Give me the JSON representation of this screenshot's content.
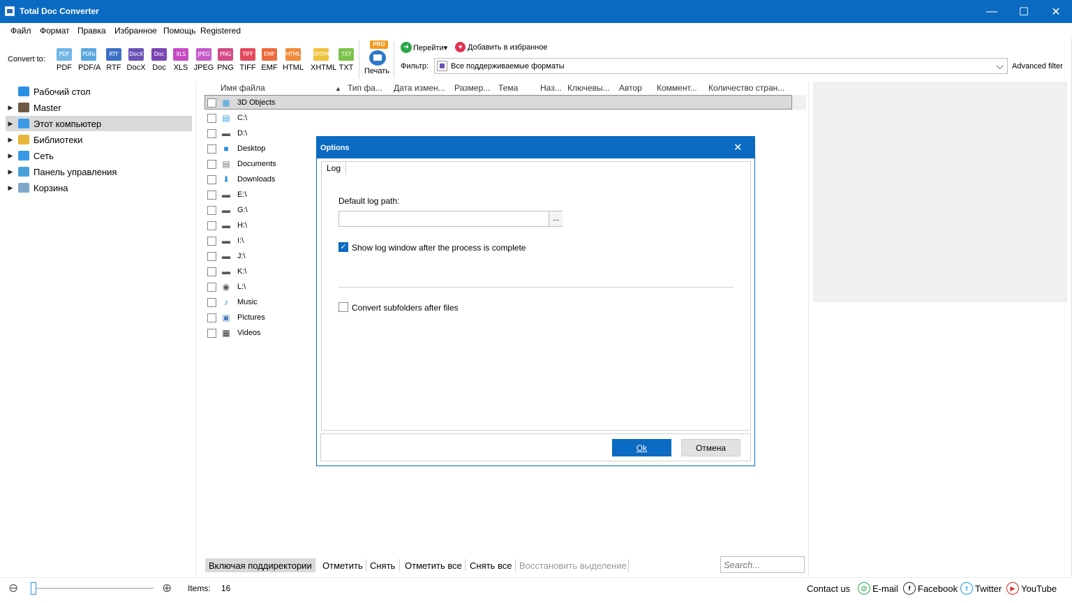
{
  "app": {
    "title": "Total Doc Converter"
  },
  "menu": [
    "Файл",
    "Формат",
    "Правка",
    "Избранное",
    "Помощь",
    "Registered"
  ],
  "toolbar": {
    "convert_to": "Convert to:",
    "formats": [
      {
        "icon": "PDF",
        "label": "PDF",
        "color": "#6fb6e6"
      },
      {
        "icon": "PDFa",
        "label": "PDF/A",
        "color": "#5aa7df"
      },
      {
        "icon": "RTF",
        "label": "RTF",
        "color": "#3b6fc6"
      },
      {
        "icon": "DocX",
        "label": "DocX",
        "color": "#6a52b5"
      },
      {
        "icon": "Doc",
        "label": "Doc",
        "color": "#7a45b0"
      },
      {
        "icon": "XLS",
        "label": "XLS",
        "color": "#c64bc2"
      },
      {
        "icon": "JPEG",
        "label": "JPEG",
        "color": "#c45ac9"
      },
      {
        "icon": "PNG",
        "label": "PNG",
        "color": "#d34a86"
      },
      {
        "icon": "TIFF",
        "label": "TIFF",
        "color": "#e24a5c"
      },
      {
        "icon": "EMF",
        "label": "EMF",
        "color": "#ec6a3b"
      },
      {
        "icon": "HTML",
        "label": "HTML",
        "color": "#f08a3b"
      },
      {
        "icon": "XHTML",
        "label": "XHTML",
        "color": "#f0c23b"
      },
      {
        "icon": "TXT",
        "label": "TXT",
        "color": "#7cc24a"
      }
    ],
    "pro_badge": "PRO",
    "print_label": "Печать",
    "goto_label": "Перейти",
    "goto_arrow": "▾",
    "favorites_label": "Добавить в избранное",
    "filter_label": "Фильтр:",
    "filter_value": "Все поддерживаемые форматы",
    "advanced_filter": "Advanced filter"
  },
  "tree": [
    {
      "label": "Рабочий стол",
      "arrow": "",
      "color": "#2b8fe3"
    },
    {
      "label": "Master",
      "arrow": "▶",
      "color": "#6e5a45"
    },
    {
      "label": "Этот компьютер",
      "arrow": "▶",
      "color": "#3a9ae8"
    },
    {
      "label": "Библиотеки",
      "arrow": "▶",
      "color": "#e8b63a"
    },
    {
      "label": "Сеть",
      "arrow": "▶",
      "color": "#3a9ae8"
    },
    {
      "label": "Панель управления",
      "arrow": "▶",
      "color": "#4aa3d8"
    },
    {
      "label": "Корзина",
      "arrow": "▶",
      "color": "#7fa7c9"
    }
  ],
  "columns": [
    "Имя файла",
    "Тип фа...",
    "Дата измен...",
    "Размер...",
    "Тема",
    "Наз...",
    "Ключевы...",
    "Автор",
    "Коммент...",
    "Количество стран..."
  ],
  "sort_arrow": "▲",
  "files": [
    {
      "name": "3D Objects",
      "icon": "▦",
      "color": "#3aa0e0"
    },
    {
      "name": "C:\\",
      "icon": "▤",
      "color": "#3aa0e0"
    },
    {
      "name": "D:\\",
      "icon": "▬",
      "color": "#555"
    },
    {
      "name": "Desktop",
      "icon": "■",
      "color": "#2b8fe3"
    },
    {
      "name": "Documents",
      "icon": "▤",
      "color": "#777"
    },
    {
      "name": "Downloads",
      "icon": "⬇",
      "color": "#2b8fe3"
    },
    {
      "name": "E:\\",
      "icon": "▬",
      "color": "#555"
    },
    {
      "name": "G:\\",
      "icon": "▬",
      "color": "#555"
    },
    {
      "name": "H:\\",
      "icon": "▬",
      "color": "#555"
    },
    {
      "name": "I:\\",
      "icon": "▬",
      "color": "#555"
    },
    {
      "name": "J:\\",
      "icon": "▬",
      "color": "#555"
    },
    {
      "name": "K:\\",
      "icon": "▬",
      "color": "#555"
    },
    {
      "name": "L:\\",
      "icon": "◉",
      "color": "#555"
    },
    {
      "name": "Music",
      "icon": "♪",
      "color": "#2b8fe3"
    },
    {
      "name": "Pictures",
      "icon": "▣",
      "color": "#4a7fb5"
    },
    {
      "name": "Videos",
      "icon": "▦",
      "color": "#333"
    }
  ],
  "dialog": {
    "title": "Options",
    "close": "✕",
    "tab": "Log",
    "default_log_path_label": "Default log path:",
    "path_value": "",
    "browse": "...",
    "show_log_label": "Show log window after the process is complete",
    "show_log_checked": true,
    "subfolders_label": "Convert subfolders after files",
    "subfolders_checked": false,
    "ok": "Ok",
    "cancel": "Отмена"
  },
  "bottom_bar": {
    "include_subdirs": "Включая поддиректории",
    "mark": "Отметить",
    "unmark": "Снять",
    "mark_all": "Отметить все",
    "unmark_all": "Снять все",
    "restore_selection": "Восстановить выделение",
    "search_placeholder": "Search..."
  },
  "status": {
    "zoom_out": "⊖",
    "zoom_in": "⊕",
    "items_label": "Items:",
    "items_count": "16",
    "contact": "Contact us",
    "email": "E-mail",
    "facebook": "Facebook",
    "twitter": "Twitter",
    "youtube": "YouTube"
  },
  "window_controls": {
    "minimize": "—",
    "maximize": "☐",
    "close": "✕"
  }
}
